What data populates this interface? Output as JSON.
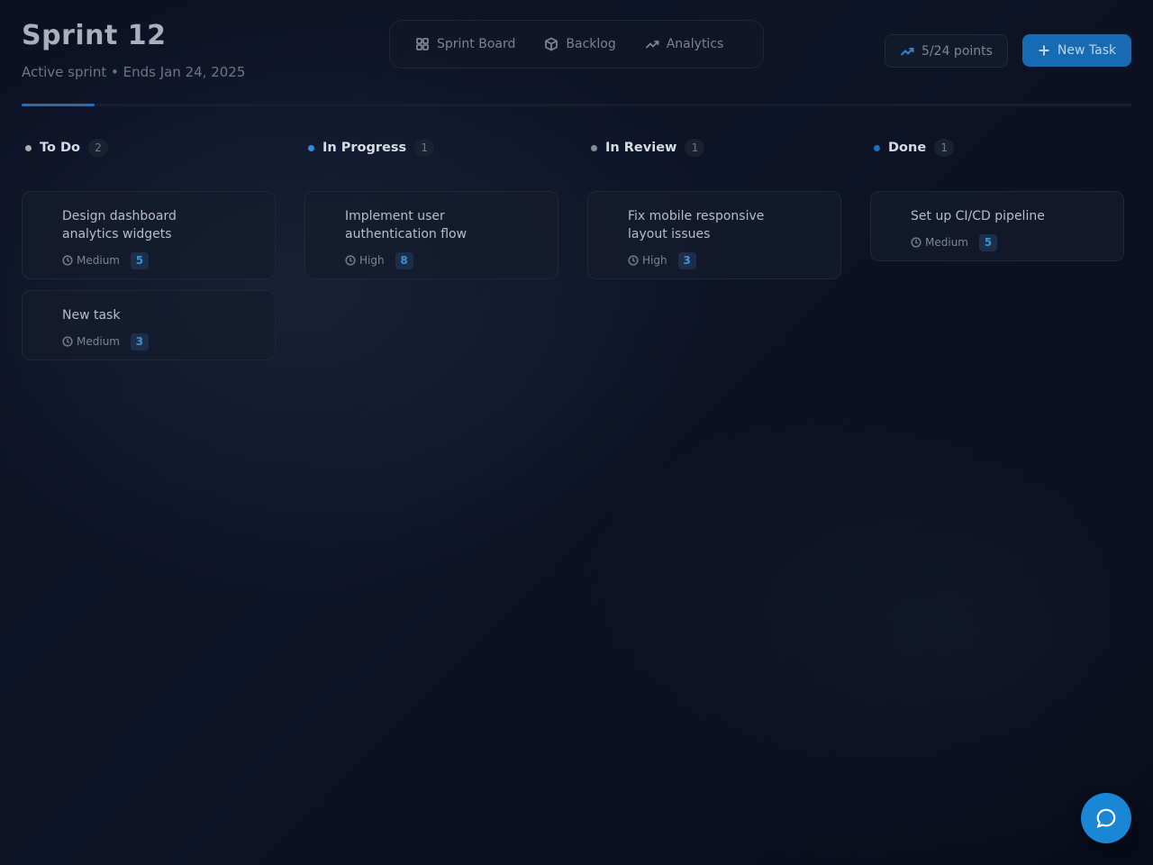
{
  "sprint": {
    "title": "Sprint 12",
    "subtitle": "Active sprint • Ends Jan 24, 2025",
    "progress_fraction": 0.066
  },
  "tabs": [
    {
      "label": "Sprint Board",
      "icon": "grid-icon"
    },
    {
      "label": "Backlog",
      "icon": "box-icon"
    },
    {
      "label": "Analytics",
      "icon": "trending-up-icon"
    }
  ],
  "points": {
    "label": "5/24 points",
    "icon": "trending-up-icon"
  },
  "new_task": {
    "label": "New Task",
    "icon": "plus-icon"
  },
  "columns": [
    {
      "title": "To Do",
      "count": "2",
      "dot_color": "#a9aeb6",
      "cards": [
        {
          "title": "Design dashboard analytics widgets",
          "priority": "Medium",
          "points": "5"
        },
        {
          "title": "New task",
          "priority": "Medium",
          "points": "3"
        }
      ]
    },
    {
      "title": "In Progress",
      "count": "1",
      "dot_color": "#2a8fe0",
      "cards": [
        {
          "title": "Implement user authentication flow",
          "priority": "High",
          "points": "8"
        }
      ]
    },
    {
      "title": "In Review",
      "count": "1",
      "dot_color": "#858a92",
      "cards": [
        {
          "title": "Fix mobile responsive layout issues",
          "priority": "High",
          "points": "3"
        }
      ]
    },
    {
      "title": "Done",
      "count": "1",
      "dot_color": "#1f6fb6",
      "cards": [
        {
          "title": "Set up CI/CD pipeline",
          "priority": "Medium",
          "points": "5"
        }
      ]
    }
  ],
  "colors": {
    "accent": "#176bb3",
    "fab": "#1a86d6",
    "points_badge_text": "#3a93dd",
    "background": "#0c1224"
  },
  "chat_button": {
    "icon": "chat-bubble-icon"
  }
}
